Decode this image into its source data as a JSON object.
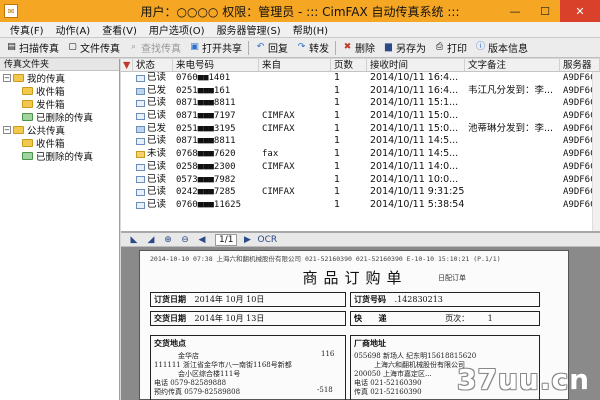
{
  "window": {
    "title": "用户：○○○○  权限：管理员 - ::: CimFAX 自动传真系统 :::",
    "app_icon": "fax-app-icon",
    "controls": [
      "—",
      "☐",
      "✕"
    ]
  },
  "menu": [
    "传真(F)",
    "动作(A)",
    "查看(V)",
    "用户选项(O)",
    "服务器管理(S)",
    "帮助(H)"
  ],
  "toolbar": [
    {
      "label": "扫描传真",
      "icon": "scan-icon",
      "enabled": true
    },
    {
      "label": "文件传真",
      "icon": "file-fax-icon",
      "enabled": true
    },
    {
      "label": "查找传真",
      "icon": "find-icon",
      "enabled": false
    },
    {
      "label": "打开共享",
      "icon": "share-icon",
      "enabled": true
    },
    {
      "label": "回复",
      "icon": "reply-icon",
      "enabled": true
    },
    {
      "label": "转发",
      "icon": "forward-icon",
      "enabled": true
    },
    {
      "label": "删除",
      "icon": "delete-icon",
      "enabled": true
    },
    {
      "label": "另存为",
      "icon": "save-as-icon",
      "enabled": true
    },
    {
      "label": "打印",
      "icon": "print-icon",
      "enabled": true
    },
    {
      "label": "版本信息",
      "icon": "info-icon",
      "enabled": true
    }
  ],
  "folders": {
    "header": "传真文件夹",
    "tree": [
      {
        "label": "我的传真",
        "level": 0,
        "expanded": true
      },
      {
        "label": "收件箱",
        "level": 1
      },
      {
        "label": "发件箱",
        "level": 1
      },
      {
        "label": "已删除的传真",
        "level": 1
      },
      {
        "label": "公共传真",
        "level": 0,
        "expanded": true
      },
      {
        "label": "收件箱",
        "level": 1
      },
      {
        "label": "已删除的传真",
        "level": 1
      }
    ]
  },
  "fax_list": {
    "columns": [
      "状态",
      "来电号码",
      "来自",
      "页数",
      "接收时间",
      "文字备注",
      "服务器"
    ],
    "rows": [
      {
        "status": "已读",
        "type": "read",
        "caller": "0760■■1401",
        "from": "",
        "pages": "1",
        "time": "2014/10/11 16:4...",
        "note": "",
        "server": "A9DF6CE"
      },
      {
        "status": "已发",
        "type": "sent",
        "caller": "0251■■■161",
        "from": "",
        "pages": "1",
        "time": "2014/10/11 16:4...",
        "note": "韦江凡分发到：李...",
        "server": "A9DF6CE"
      },
      {
        "status": "已读",
        "type": "read",
        "caller": "0871■■■8811",
        "from": "",
        "pages": "1",
        "time": "2014/10/11 15:1...",
        "note": "",
        "server": "A9DF6CE"
      },
      {
        "status": "已读",
        "type": "read",
        "caller": "0871■■■7197",
        "from": "CIMFAX",
        "pages": "1",
        "time": "2014/10/11 15:0...",
        "note": "",
        "server": "A9DF6CE"
      },
      {
        "status": "已发",
        "type": "sent",
        "caller": "0251■■■3195",
        "from": "CIMFAX",
        "pages": "1",
        "time": "2014/10/11 15:0...",
        "note": "池蒂琳分发到：李...",
        "server": "A9DF6CE"
      },
      {
        "status": "已读",
        "type": "read",
        "caller": "0871■■■8811",
        "from": "",
        "pages": "1",
        "time": "2014/10/11 14:5...",
        "note": "",
        "server": "A9DF6CE"
      },
      {
        "status": "未读",
        "type": "unread",
        "caller": "0768■■■7620",
        "from": "fax",
        "pages": "1",
        "time": "2014/10/11 14:5...",
        "note": "",
        "server": "A9DF6CE"
      },
      {
        "status": "已读",
        "type": "read",
        "caller": "0258■■■2300",
        "from": "CIMFAX",
        "pages": "1",
        "time": "2014/10/11 14:0...",
        "note": "",
        "server": "A9DF6CE"
      },
      {
        "status": "已读",
        "type": "read",
        "caller": "0573■■■7982",
        "from": "",
        "pages": "1",
        "time": "2014/10/11 10:0...",
        "note": "",
        "server": "A9DF6CE"
      },
      {
        "status": "已读",
        "type": "read",
        "caller": "0242■■■7285",
        "from": "CIMFAX",
        "pages": "1",
        "time": "2014/10/11 9:31:25",
        "note": "",
        "server": "A9DF6CE"
      },
      {
        "status": "已读",
        "type": "read",
        "caller": "0760■■■11625",
        "from": "",
        "pages": "1",
        "time": "2014/10/11 5:38:54",
        "note": "",
        "server": "A9DF6CE"
      }
    ]
  },
  "preview_toolbar": {
    "page_indicator": "1/1",
    "buttons": [
      "rotate-left-icon",
      "rotate-right-icon",
      "zoom-in-icon",
      "zoom-out-icon",
      "prev-page-icon",
      "next-page-icon",
      "ocr-icon"
    ],
    "ocr_label": "OCR"
  },
  "fax_document": {
    "fax_header": "2014-10-10 07:38 上海六和翻机械股份有限公司 021-52160390 021-52160390 E-10-10 15:10:21 (P.1/1)",
    "title": "商品订购单",
    "subtitle": "日配订单",
    "order_date_label": "订货日期",
    "order_date": "2014年 10月 10日",
    "order_no_label": "订货号码",
    "order_no": ".142830213",
    "delivery_date_label": "交货日期",
    "delivery_date": "2014年 10月 13日",
    "rush_label": "快",
    "rush_value": "递",
    "page_label": "页次：",
    "page_value": "1",
    "delivery_place_label": "交货地点",
    "delivery_place_lines": [
      "金华店",
      "111111 浙江省金华市八一南街1168号新都",
      "会小区综合楼111号",
      "电话 0579-82589888",
      "预约传真 0579-82589808"
    ],
    "delivery_extra_1": "116",
    "delivery_extra_2": "-518",
    "vendor_label": "厂商地址",
    "vendor_lines": [
      "055698  新场人 纪东明15618815620",
      "上海六和翻机械股份有限公司",
      "200050 上海市嘉定区...",
      "电话 021-52160390",
      "传真 021-52160390"
    ],
    "watermark": "37uu.cn"
  }
}
